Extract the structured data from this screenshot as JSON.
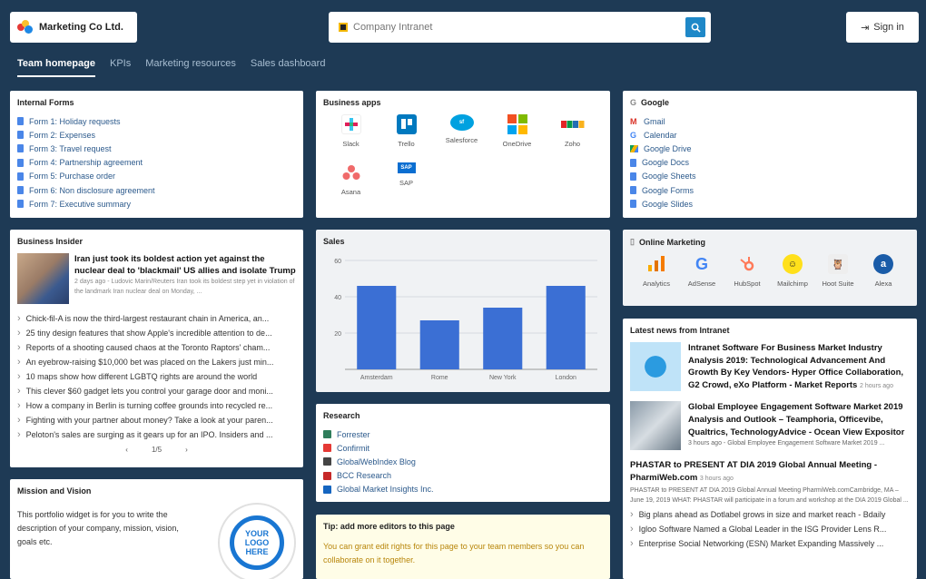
{
  "brand": {
    "name": "Marketing Co Ltd."
  },
  "search": {
    "placeholder": "Company Intranet"
  },
  "signin": {
    "label": "Sign in"
  },
  "tabs": [
    "Team homepage",
    "KPIs",
    "Marketing resources",
    "Sales dashboard"
  ],
  "internal_forms": {
    "title": "Internal Forms",
    "items": [
      "Form 1: Holiday requests",
      "Form 2: Expenses",
      "Form 3: Travel request",
      "Form 4: Partnership agreement",
      "Form 5: Purchase order",
      "Form 6: Non disclosure agreement",
      "Form 7: Executive summary"
    ]
  },
  "business_apps": {
    "title": "Business apps",
    "items": [
      {
        "label": "Slack",
        "icon": "slack-icon",
        "color": "#e01e5a"
      },
      {
        "label": "Trello",
        "icon": "trello-icon",
        "color": "#0079bf"
      },
      {
        "label": "Salesforce",
        "icon": "salesforce-icon",
        "color": "#00a1e0"
      },
      {
        "label": "OneDrive",
        "icon": "onedrive-icon",
        "color": "#f25022"
      },
      {
        "label": "Zoho",
        "icon": "zoho-icon",
        "color": "#e42527"
      },
      {
        "label": "Asana",
        "icon": "asana-icon",
        "color": "#f06a6a"
      },
      {
        "label": "SAP",
        "icon": "sap-icon",
        "color": "#0a6ed1"
      }
    ]
  },
  "google": {
    "title": "Google",
    "items": [
      "Gmail",
      "Calendar",
      "Google Drive",
      "Google Docs",
      "Google Sheets",
      "Google Forms",
      "Google Slides"
    ]
  },
  "business_insider": {
    "title": "Business Insider",
    "headline": "Iran just took its boldest action yet against the nuclear deal to 'blackmail' US allies and isolate Trump",
    "meta": "2 days ago",
    "summary": "Ludovic Marin/Reuters Iran took its boldest step yet in violation of the landmark Iran nuclear deal on Monday, ...",
    "items": [
      "Chick-fil-A is now the third-largest restaurant chain in America, an...",
      "25 tiny design features that show Apple's incredible attention to de...",
      "Reports of a shooting caused chaos at the Toronto Raptors' cham...",
      "An eyebrow-raising $10,000 bet was placed on the Lakers just min...",
      "10 maps show how different LGBTQ rights are around the world",
      "This clever $60 gadget lets you control your garage door and moni...",
      "How a company in Berlin is turning coffee grounds into recycled re...",
      "Fighting with your partner about money? Take a look at your paren...",
      "Peloton's sales are surging as it gears up for an IPO. Insiders and ..."
    ],
    "pager": "1/5"
  },
  "sales": {
    "title": "Sales"
  },
  "chart_data": {
    "type": "bar",
    "title": "Sales",
    "categories": [
      "Amsterdam",
      "Rome",
      "New York",
      "London"
    ],
    "values": [
      46,
      27,
      34,
      46
    ],
    "ylim": [
      0,
      60
    ],
    "yticks": [
      20,
      40,
      60
    ],
    "color": "#3b6fd4",
    "grid": true
  },
  "online_marketing": {
    "title": "Online Marketing",
    "items": [
      {
        "label": "Analytics",
        "icon": "analytics-icon",
        "color": "#f57c00"
      },
      {
        "label": "AdSense",
        "icon": "adsense-icon",
        "color": "#4285f4"
      },
      {
        "label": "HubSpot",
        "icon": "hubspot-icon",
        "color": "#ff7a59"
      },
      {
        "label": "Mailchimp",
        "icon": "mailchimp-icon",
        "color": "#222222"
      },
      {
        "label": "Hoot Suite",
        "icon": "hootsuite-icon",
        "color": "#333333"
      },
      {
        "label": "Alexa",
        "icon": "alexa-icon",
        "color": "#1a5ca8"
      }
    ]
  },
  "latest_news": {
    "title": "Latest news from Intranet",
    "items": [
      {
        "title": "Intranet Software For Business Market Industry Analysis 2019: Technological Advancement And Growth By Key Vendors- Hyper Office Collaboration, G2 Crowd, eXo Platform - Market Reports",
        "meta": "2 hours ago"
      },
      {
        "title": "Global Employee Engagement Software Market 2019 Analysis and Outlook – Teamphoria, Officevibe, Qualtrics, TechnologyAdvice - Ocean View Expositor",
        "meta": "3 hours ago",
        "summary": "Global Employee Engagement Software Market 2019 ..."
      },
      {
        "title": "PHASTAR to PRESENT AT DIA 2019 Global Annual Meeting - PharmiWeb.com",
        "meta": "3 hours ago",
        "summary": "PHASTAR to PRESENT AT DIA 2019 Global Annual Meeting PharmiWeb.comCambridge, MA – June 19, 2019 WHAT: PHASTAR will participate in a forum and workshop at the DIA 2019 Global ..."
      }
    ],
    "more": [
      "Big plans ahead as Dotlabel grows in size and market reach - Bdaily",
      "Igloo Software Named a Global Leader in the ISG Provider Lens R...",
      "Enterprise Social Networking (ESN) Market Expanding Massively ..."
    ]
  },
  "research": {
    "title": "Research",
    "items": [
      {
        "label": "Forrester",
        "color": "#2e7d5b"
      },
      {
        "label": "Confirmit",
        "color": "#e53935"
      },
      {
        "label": "GlobalWebIndex Blog",
        "color": "#444444"
      },
      {
        "label": "BCC Research",
        "color": "#c62828"
      },
      {
        "label": "Global Market Insights Inc.",
        "color": "#1565c0"
      }
    ]
  },
  "mission": {
    "title": "Mission and Vision",
    "text": "This portfolio widget is for you to write the description of your company, mission, vision, goals etc.",
    "logo_text": "YOUR LOGO HERE"
  },
  "tip": {
    "title": "Tip: add more editors to this page",
    "text": "You can grant edit rights for this page to your team members so you can collaborate on it together."
  }
}
